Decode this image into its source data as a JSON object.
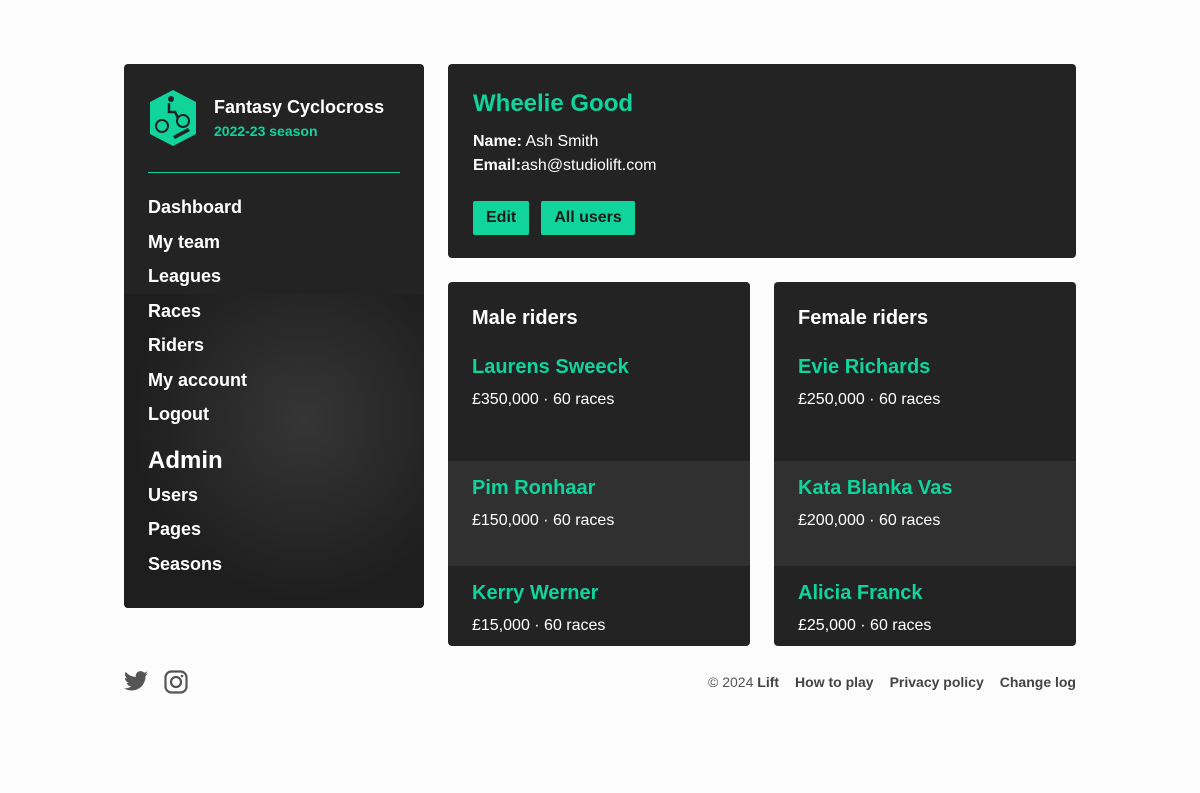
{
  "brand": {
    "title": "Fantasy Cyclocross",
    "season": "2022-23 season",
    "accent": "#10d49c"
  },
  "nav": [
    "Dashboard",
    "My team",
    "Leagues",
    "Races",
    "Riders",
    "My account",
    "Logout"
  ],
  "admin": {
    "heading": "Admin",
    "items": [
      "Users",
      "Pages",
      "Seasons"
    ]
  },
  "team": {
    "name": "Wheelie Good",
    "name_label": "Name:",
    "name_value": "Ash Smith",
    "email_label": "Email:",
    "email_value": "ash@studiolift.com",
    "edit": "Edit",
    "all_users": "All users"
  },
  "male": {
    "title": "Male riders",
    "riders": [
      {
        "name": "Laurens Sweeck",
        "details": "£350,000 · 60 races"
      },
      {
        "name": "Pim Ronhaar",
        "details": "£150,000 · 60 races"
      },
      {
        "name": "Kerry Werner",
        "details": "£15,000 · 60 races"
      }
    ]
  },
  "female": {
    "title": "Female riders",
    "riders": [
      {
        "name": "Evie Richards",
        "details": "£250,000 · 60 races"
      },
      {
        "name": "Kata Blanka Vas",
        "details": "£200,000 · 60 races"
      },
      {
        "name": "Alicia Franck",
        "details": "£25,000 · 60 races"
      }
    ]
  },
  "footer": {
    "copyright": "© 2024",
    "lift": "Lift",
    "links": [
      "How to play",
      "Privacy policy",
      "Change log"
    ]
  }
}
